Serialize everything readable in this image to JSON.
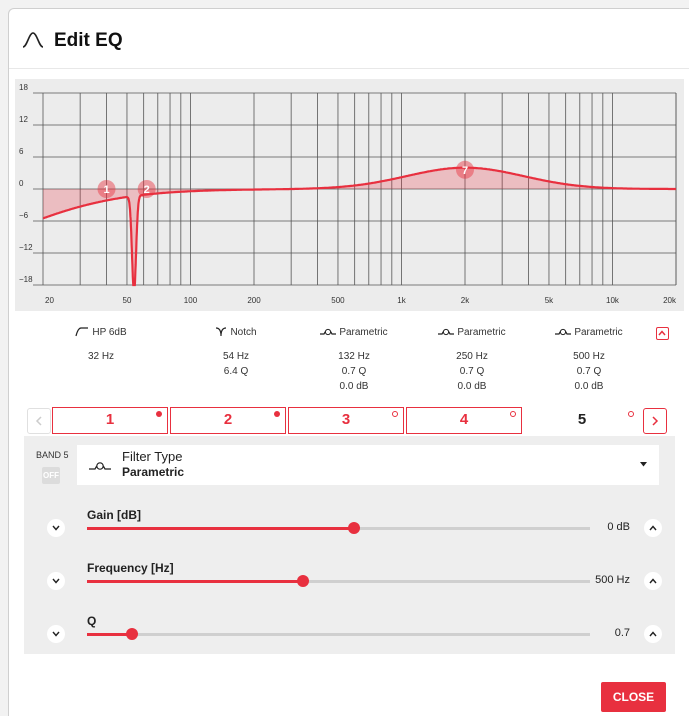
{
  "dialog": {
    "title": "Edit EQ"
  },
  "graph": {
    "y_ticks": [
      "18",
      "12",
      "6",
      "0",
      "−6",
      "−12",
      "−18"
    ],
    "x_ticks": [
      "20",
      "50",
      "100",
      "200",
      "500",
      "1k",
      "2k",
      "5k",
      "10k",
      "20k"
    ],
    "markers": [
      "1",
      "2",
      "7"
    ],
    "curve_color": "#e8303f"
  },
  "bands_info": [
    {
      "type": "HP 6dB",
      "icon": "highpass-icon",
      "values": [
        "32 Hz"
      ]
    },
    {
      "type": "Notch",
      "icon": "notch-icon",
      "values": [
        "54 Hz",
        "6.4 Q"
      ]
    },
    {
      "type": "Parametric",
      "icon": "parametric-icon",
      "values": [
        "132 Hz",
        "0.7 Q",
        "0.0 dB"
      ]
    },
    {
      "type": "Parametric",
      "icon": "parametric-icon",
      "values": [
        "250 Hz",
        "0.7 Q",
        "0.0 dB"
      ]
    },
    {
      "type": "Parametric",
      "icon": "parametric-icon",
      "values": [
        "500 Hz",
        "0.7 Q",
        "0.0 dB"
      ]
    }
  ],
  "tabs": [
    {
      "label": "1",
      "dot": "filled"
    },
    {
      "label": "2",
      "dot": "filled"
    },
    {
      "label": "3",
      "dot": "hollow"
    },
    {
      "label": "4",
      "dot": "hollow"
    },
    {
      "label": "5",
      "dot": "hollow",
      "active": true
    }
  ],
  "band_panel": {
    "band_label": "BAND 5",
    "toggle_label": "OFF",
    "filter_type_label": "Filter Type",
    "filter_type_value": "Parametric",
    "params": [
      {
        "label": "Gain [dB]",
        "value": "0 dB",
        "fraction": 0.53
      },
      {
        "label": "Frequency [Hz]",
        "value": "500 Hz",
        "fraction": 0.43
      },
      {
        "label": "Q",
        "value": "0.7",
        "fraction": 0.09
      }
    ]
  },
  "footer": {
    "close_label": "CLOSE"
  },
  "colors": {
    "accent": "#e8303f",
    "panel": "#eeeeee",
    "graph_bg": "#ececec"
  }
}
